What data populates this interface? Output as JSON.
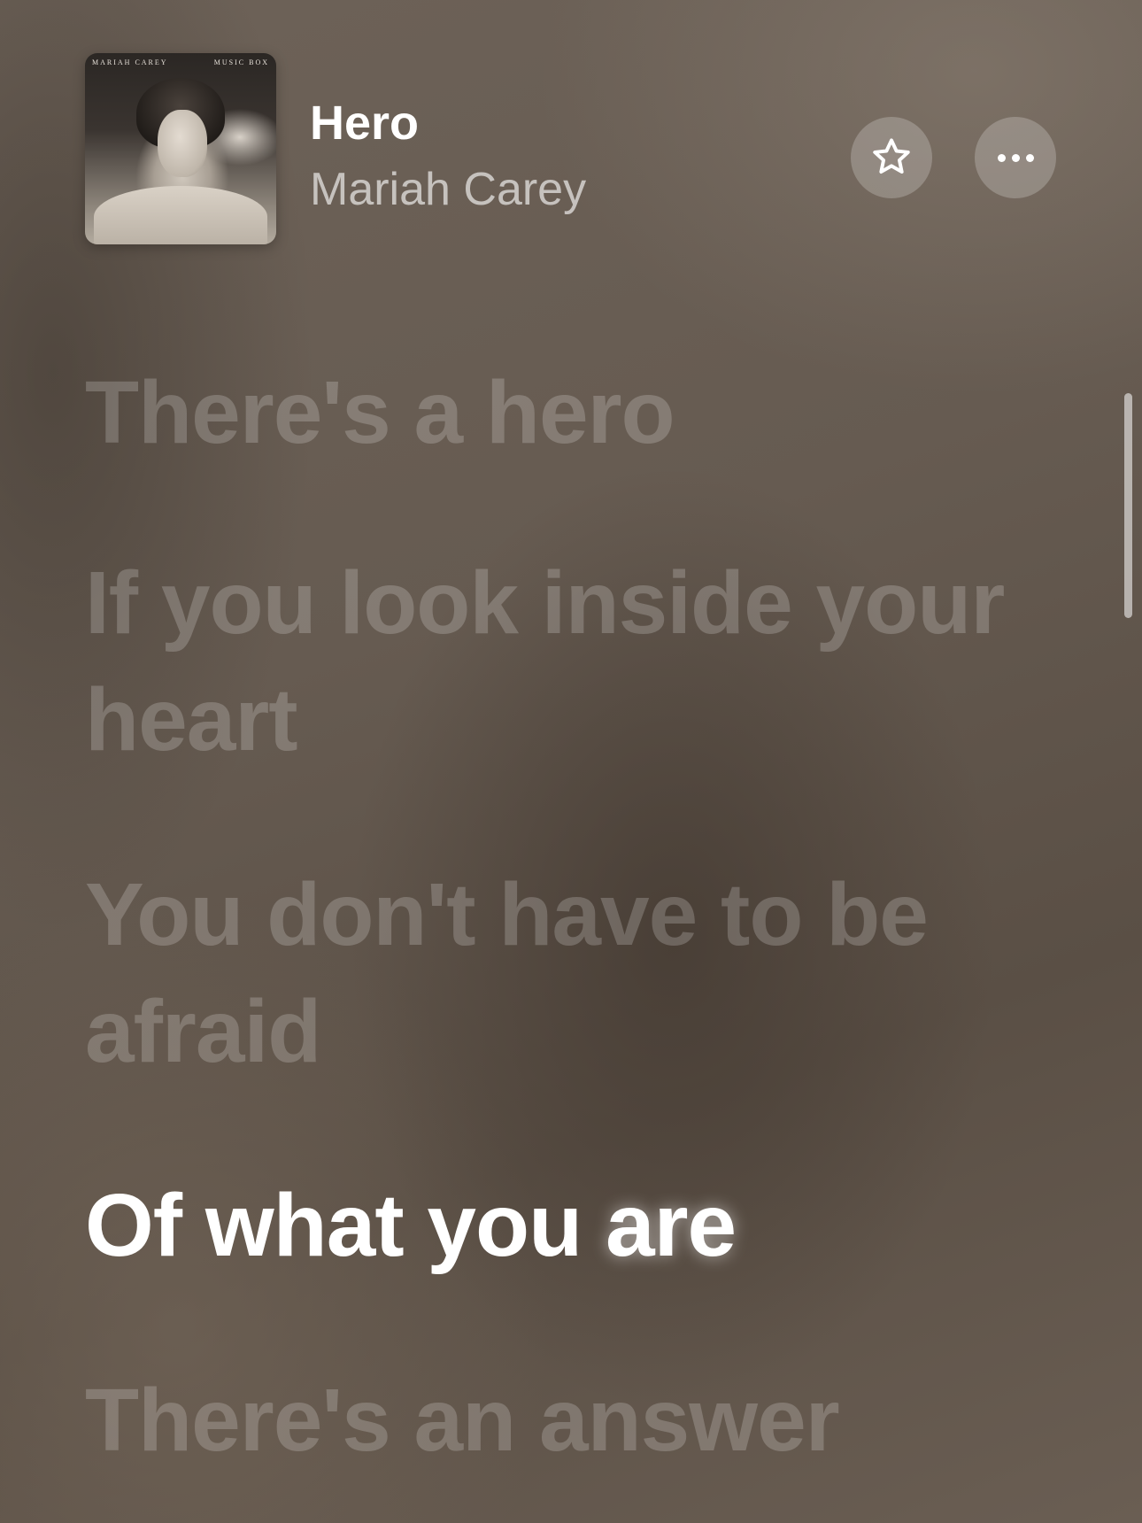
{
  "now_playing": {
    "title": "Hero",
    "artist": "Mariah Carey",
    "artwork": {
      "artist_text": "MARIAH CAREY",
      "album_text": "MUSIC BOX"
    }
  },
  "controls": {
    "favorite_icon": "star-icon",
    "more_icon": "ellipsis-icon"
  },
  "lyrics": {
    "lines": [
      {
        "text": "There's a hero",
        "state": "past"
      },
      {
        "text": "If you look inside your heart",
        "state": "past"
      },
      {
        "text": "You don't have to be afraid",
        "state": "past"
      },
      {
        "text_before": "Of what you",
        "text_highlight": "are",
        "state": "current"
      },
      {
        "text": "There's an answer",
        "state": "upcoming"
      }
    ]
  },
  "colors": {
    "active_lyric": "#ffffff",
    "inactive_lyric": "rgba(255,255,255,0.2)",
    "background": "#6e6257"
  }
}
